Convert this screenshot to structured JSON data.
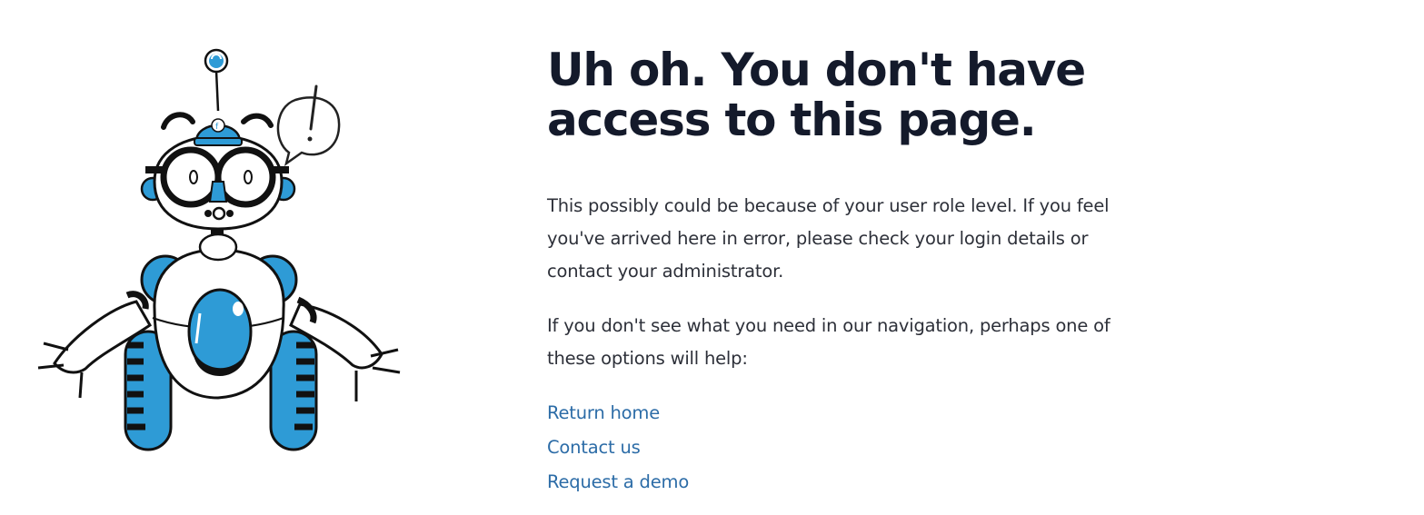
{
  "page": {
    "heading": "Uh oh. You don't have access to this page.",
    "paragraph_1": "This possibly could be because of your user role level. If you feel you've arrived here in error, please check your login details or contact your administrator.",
    "paragraph_2": "If you don't see what you need in our navigation, perhaps one of these options will help:",
    "links": [
      {
        "label": "Return home"
      },
      {
        "label": "Contact us"
      },
      {
        "label": "Request a demo"
      }
    ]
  },
  "colors": {
    "heading": "#141a2b",
    "body_text": "#2d3039",
    "link": "#2c6ca7",
    "robot_blue": "#2e9bd6",
    "robot_outline": "#111111"
  },
  "illustration": {
    "subject": "robot-mascot",
    "icons": [
      "antenna-icon",
      "cap-icon",
      "speech-bubble-exclamation-icon",
      "wheel-icon"
    ]
  }
}
